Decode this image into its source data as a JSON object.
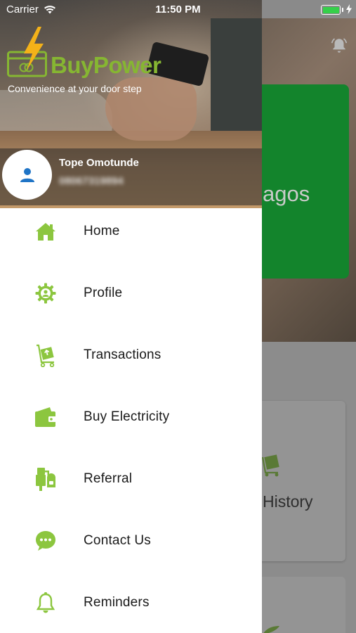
{
  "status_bar": {
    "carrier": "Carrier",
    "time": "11:50 PM",
    "battery_color": "#35d04a"
  },
  "background_app": {
    "hero_text": "agos",
    "card_label": "History",
    "accent_green": "#13842c"
  },
  "drawer": {
    "brand": "BuyPower",
    "tagline": "Convenience at your door step",
    "brand_color": "#86b632",
    "user": {
      "name": "Tope Omotunde",
      "phone": "08067319894"
    },
    "menu_items": [
      {
        "label": "Home",
        "icon": "home-icon"
      },
      {
        "label": "Profile",
        "icon": "profile-gear-icon"
      },
      {
        "label": "Transactions",
        "icon": "transactions-trolley-icon"
      },
      {
        "label": "Buy Electricity",
        "icon": "wallet-icon"
      },
      {
        "label": "Referral",
        "icon": "referral-mailbox-icon"
      },
      {
        "label": "Contact Us",
        "icon": "chat-bubble-icon"
      },
      {
        "label": "Reminders",
        "icon": "bell-icon"
      }
    ],
    "icon_color": "#8cc63f"
  }
}
